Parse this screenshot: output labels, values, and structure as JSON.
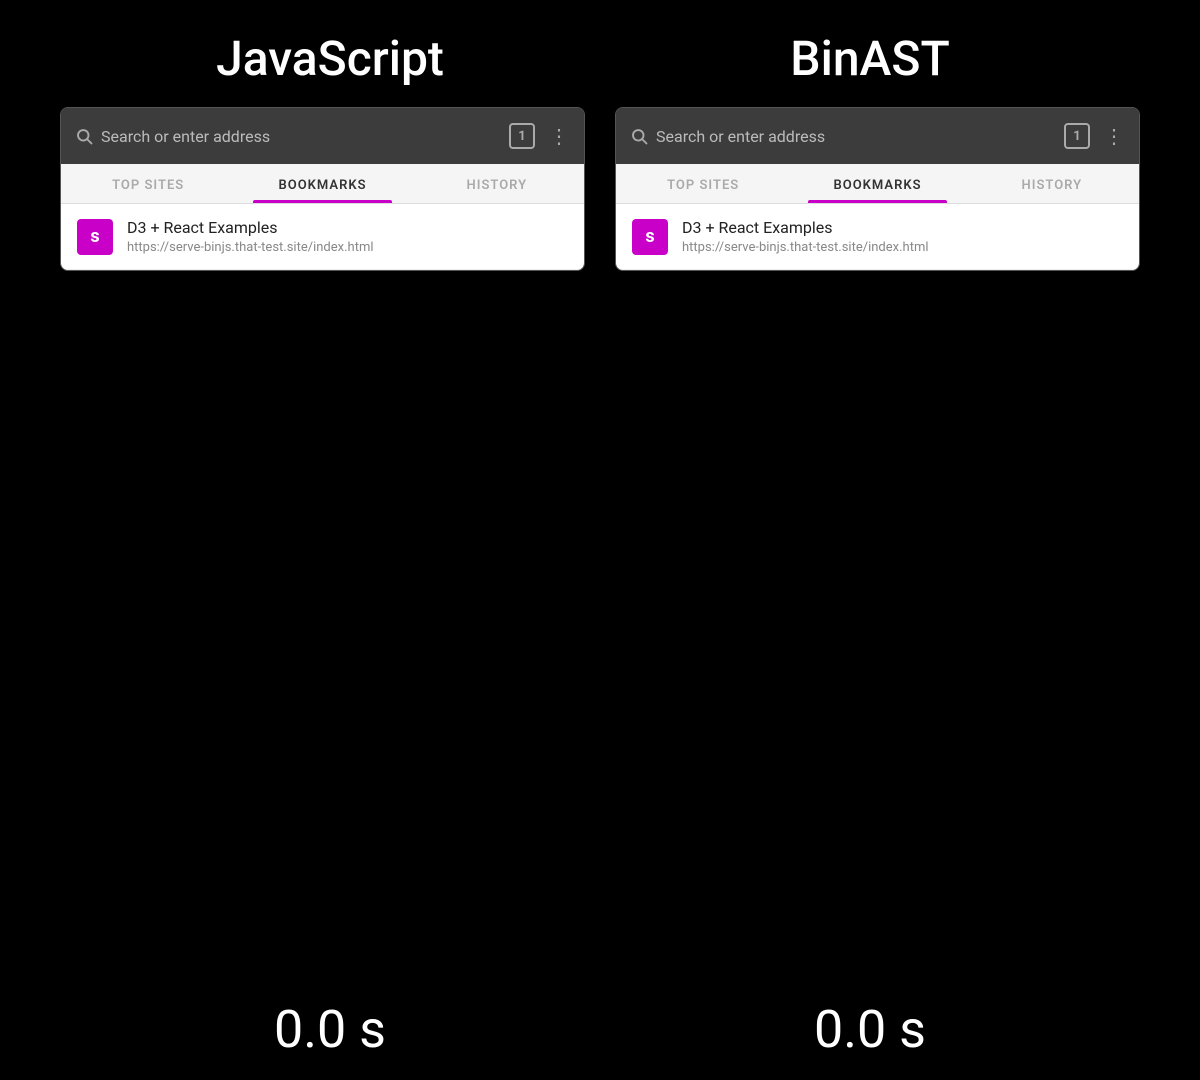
{
  "left": {
    "top_label": "JavaScript",
    "address_bar": {
      "placeholder": "Search or enter address",
      "tab_count": "1"
    },
    "tabs": [
      {
        "id": "top-sites",
        "label": "TOP SITES",
        "active": false
      },
      {
        "id": "bookmarks",
        "label": "BOOKMARKS",
        "active": true
      },
      {
        "id": "history",
        "label": "HISTORY",
        "active": false
      }
    ],
    "bookmark": {
      "icon_letter": "s",
      "title": "D3 + React Examples",
      "url": "https://serve-binjs.that-test.site/index.html"
    },
    "bottom_label": "0.0 s"
  },
  "right": {
    "top_label": "BinAST",
    "address_bar": {
      "placeholder": "Search or enter address",
      "tab_count": "1"
    },
    "tabs": [
      {
        "id": "top-sites",
        "label": "TOP SITES",
        "active": false
      },
      {
        "id": "bookmarks",
        "label": "BOOKMARKS",
        "active": true
      },
      {
        "id": "history",
        "label": "HISTORY",
        "active": false
      }
    ],
    "bookmark": {
      "icon_letter": "s",
      "title": "D3 + React Examples",
      "url": "https://serve-binjs.that-test.site/index.html"
    },
    "bottom_label": "0.0 s"
  }
}
